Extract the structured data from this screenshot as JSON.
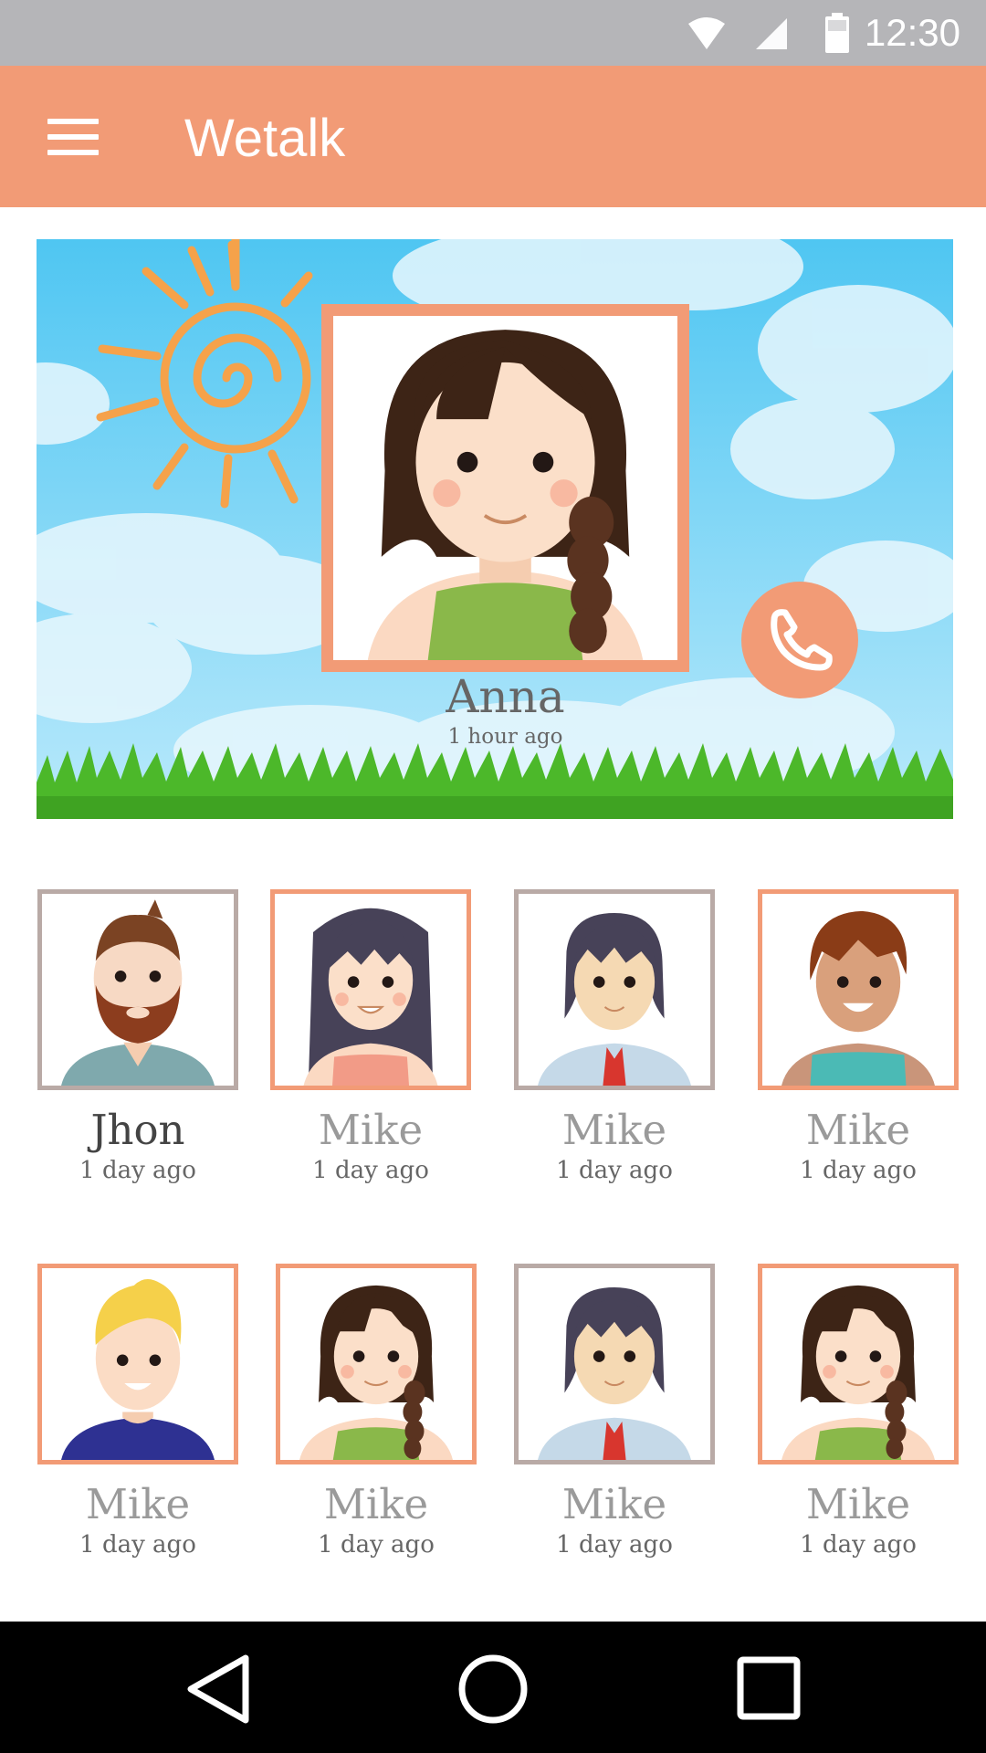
{
  "status_bar": {
    "time": "12:30",
    "icons": [
      "wifi-icon",
      "signal-icon",
      "battery-icon"
    ]
  },
  "app_bar": {
    "title": "Wetalk",
    "menu_icon": "hamburger-menu-icon"
  },
  "featured": {
    "name": "Anna",
    "last_seen": "1 hour ago",
    "call_icon": "phone-icon"
  },
  "contacts": [
    {
      "name": "Jhon",
      "last_seen": "1 day ago",
      "avatar": "bearded-man"
    },
    {
      "name": "Mike",
      "last_seen": "1 day ago",
      "avatar": "long-dark-hair-girl"
    },
    {
      "name": "Mike",
      "last_seen": "1 day ago",
      "avatar": "man-with-tie"
    },
    {
      "name": "Mike",
      "last_seen": "1 day ago",
      "avatar": "brown-hair-person"
    },
    {
      "name": "Mike",
      "last_seen": "1 day ago",
      "avatar": "blond-man"
    },
    {
      "name": "Mike",
      "last_seen": "1 day ago",
      "avatar": "braided-girl"
    },
    {
      "name": "Mike",
      "last_seen": "1 day ago",
      "avatar": "man-with-tie"
    },
    {
      "name": "Mike",
      "last_seen": "1 day ago",
      "avatar": "braided-girl"
    }
  ],
  "nav_bar": {
    "icons": [
      "back-icon",
      "home-icon",
      "recents-icon"
    ]
  },
  "colors": {
    "accent": "#f29b76",
    "status_bar": "#b5b5b8",
    "sky": "#7fd2f5",
    "grass": "#4cb82a"
  }
}
